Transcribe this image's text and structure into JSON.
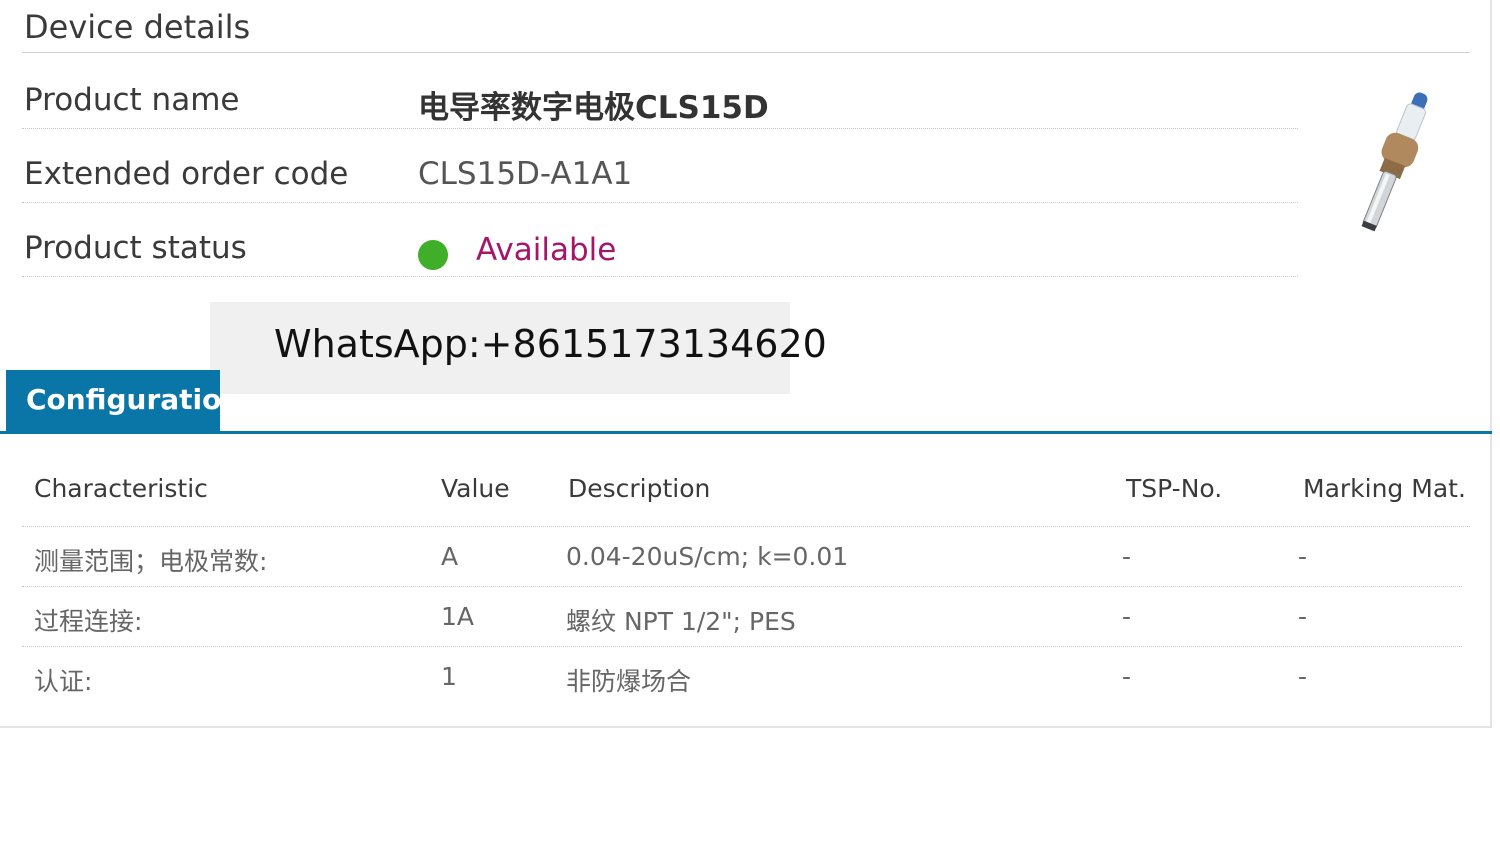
{
  "device_details": {
    "title": "Device details",
    "rows": [
      {
        "label": "Product name",
        "value": "电导率数字电极CLS15D"
      },
      {
        "label": "Extended order code",
        "value": "CLS15D-A1A1"
      },
      {
        "label": "Product status",
        "value": "Available",
        "status_color": "#3fae29"
      }
    ],
    "image": "conductivity-sensor-product-photo"
  },
  "overlay": {
    "text": "WhatsApp:+8615173134620"
  },
  "tabs": [
    {
      "label": "Configuration",
      "active": true
    }
  ],
  "table": {
    "headers": [
      "Characteristic",
      "Value",
      "Description",
      "TSP-No.",
      "Marking Mat."
    ],
    "rows": [
      [
        "测量范围；电极常数:",
        "A",
        "0.04-20uS/cm; k=0.01",
        "-",
        "-"
      ],
      [
        "过程连接:",
        "1A",
        "螺纹 NPT 1/2\"; PES",
        "-",
        "-"
      ],
      [
        "认证:",
        "1",
        "非防爆场合",
        "-",
        "-"
      ]
    ]
  },
  "colors": {
    "accent": "#0a76a8",
    "status_text": "#a5166a",
    "status_ok": "#3fae29"
  }
}
